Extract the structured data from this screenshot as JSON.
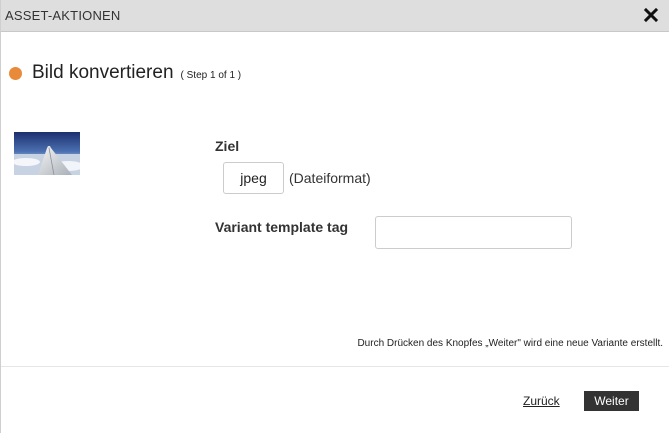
{
  "dialog": {
    "title": "ASSET-AKTIONEN",
    "close_icon": "close-icon"
  },
  "heading": {
    "text": "Bild konvertieren",
    "step": "( Step 1 of 1 )",
    "dot_color": "#e98a3b"
  },
  "thumbnail": {
    "icon": "asset-thumbnail"
  },
  "form": {
    "target_label": "Ziel",
    "format_value": "jpeg",
    "format_hint": "(Dateiformat)",
    "variant_label": "Variant template tag",
    "variant_value": ""
  },
  "footer": {
    "note": "Durch Drücken des Knopfes „Weiter\" wird eine neue Variante erstellt.",
    "back_label": "Zurück",
    "next_label": "Weiter"
  }
}
